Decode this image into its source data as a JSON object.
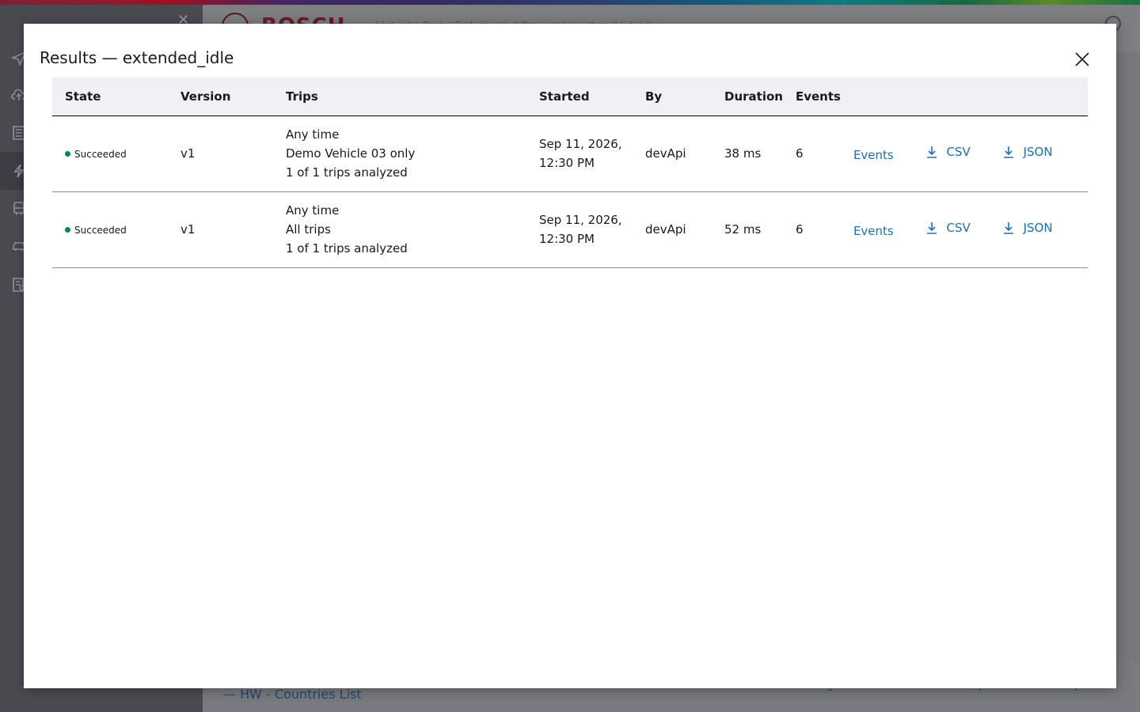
{
  "background": {
    "brand": "BOSCH",
    "header_text": "Vehicle Data Solutions / Dynamic extended_idle",
    "footer_link": "HW - Countries List",
    "footer_links": "Legal notes    Terms of use    Report vulnerability"
  },
  "modal": {
    "title": "Results — extended_idle",
    "columns": [
      "State",
      "Version",
      "Trips",
      "Started",
      "By",
      "Duration",
      "Events"
    ],
    "rows": [
      {
        "state": "Succeeded",
        "version": "v1",
        "trips_line1": "Any time",
        "trips_line2": "Demo Vehicle 03 only",
        "trips_line3": "1 of 1 trips analyzed",
        "started_line1": "Sep 11, 2026,",
        "started_line2": "12:30 PM",
        "by": "devApi",
        "duration": "38 ms",
        "events": "6",
        "action_events": "Events",
        "action_csv": "CSV",
        "action_json": "JSON"
      },
      {
        "state": "Succeeded",
        "version": "v1",
        "trips_line1": "Any time",
        "trips_line2": "All trips",
        "trips_line3": "1 of 1 trips analyzed",
        "started_line1": "Sep 11, 2026,",
        "started_line2": "12:30 PM",
        "by": "devApi",
        "duration": "52 ms",
        "events": "6",
        "action_events": "Events",
        "action_csv": "CSV",
        "action_json": "JSON"
      }
    ]
  },
  "colors": {
    "success": "#00884a",
    "link": "#1f6fb0",
    "header_bg": "#eff1f2"
  }
}
